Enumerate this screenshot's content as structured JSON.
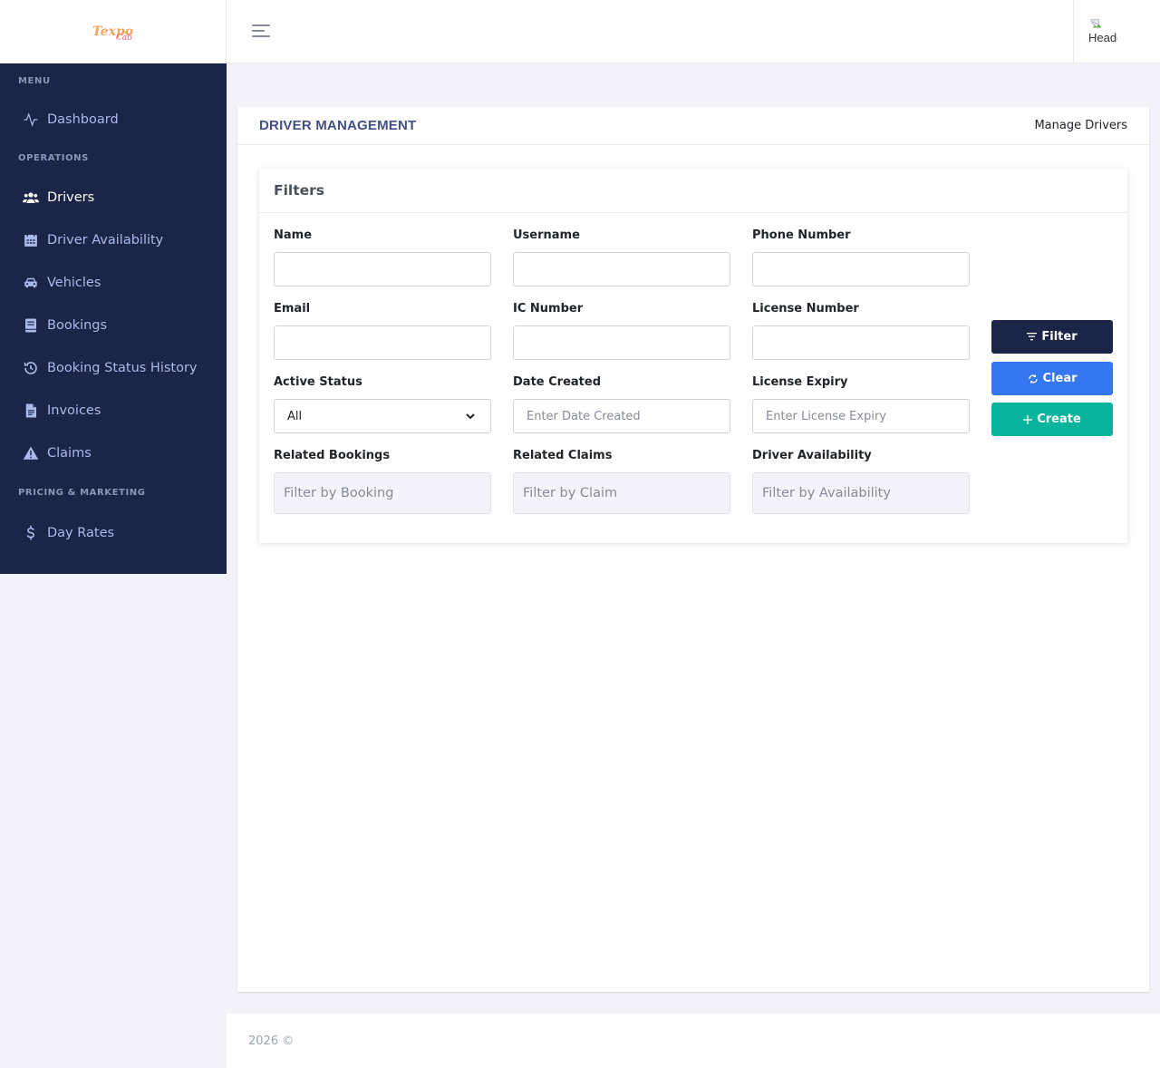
{
  "brand": {
    "logo_main": "Texpo",
    "logo_sub": "Cab"
  },
  "colors": {
    "sidebar_bg": "#1a2547",
    "title_accent": "#405189",
    "filter_button": "#1a2547",
    "clear_button": "#3577f1",
    "create_button": "#0ab39c"
  },
  "sidebar": {
    "sections": {
      "menu": "MENU",
      "operations": "OPERATIONS",
      "pricing": "PRICING & MARKETING"
    },
    "items": [
      {
        "label": "Dashboard",
        "icon": "activity-icon"
      },
      {
        "label": "Drivers",
        "icon": "users-icon",
        "active": true
      },
      {
        "label": "Driver Availability",
        "icon": "calendar-icon"
      },
      {
        "label": "Vehicles",
        "icon": "car-icon"
      },
      {
        "label": "Bookings",
        "icon": "book-icon"
      },
      {
        "label": "Booking Status History",
        "icon": "history-icon"
      },
      {
        "label": "Invoices",
        "icon": "invoice-icon"
      },
      {
        "label": "Claims",
        "icon": "warning-icon"
      },
      {
        "label": "Day Rates",
        "icon": "dollar-icon"
      }
    ]
  },
  "header": {
    "avatar_alt": "Header Avatar"
  },
  "page": {
    "title": "DRIVER MANAGEMENT",
    "breadcrumb": "Manage Drivers"
  },
  "filters": {
    "title": "Filters",
    "fields": {
      "name": {
        "label": "Name",
        "value": ""
      },
      "username": {
        "label": "Username",
        "value": ""
      },
      "phone": {
        "label": "Phone Number",
        "value": ""
      },
      "email": {
        "label": "Email",
        "value": ""
      },
      "ic": {
        "label": "IC Number",
        "value": ""
      },
      "license": {
        "label": "License Number",
        "value": ""
      },
      "active_status": {
        "label": "Active Status",
        "value": "All"
      },
      "date_created": {
        "label": "Date Created",
        "placeholder": "Enter Date Created"
      },
      "license_expiry": {
        "label": "License Expiry",
        "placeholder": "Enter License Expiry"
      },
      "related_bookings": {
        "label": "Related Bookings",
        "placeholder": "Filter by Booking"
      },
      "related_claims": {
        "label": "Related Claims",
        "placeholder": "Filter by Claim"
      },
      "driver_availability": {
        "label": "Driver Availability",
        "placeholder": "Filter by Availability"
      }
    },
    "buttons": {
      "filter": "Filter",
      "clear": "Clear",
      "create": "Create"
    }
  },
  "footer": {
    "text": "2026 ©"
  }
}
